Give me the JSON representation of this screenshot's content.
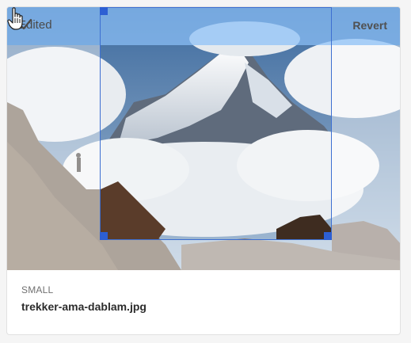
{
  "status": {
    "edited_label": "Edited",
    "revert_label": "Revert"
  },
  "asset": {
    "size_label": "SMALL",
    "filename": "trekker-ama-dablam.jpg"
  },
  "icons": {
    "status": "checkmark-icon",
    "cursor": "hand-pointer-icon"
  },
  "colors": {
    "status_bar": "#8CC0F8",
    "crop_border": "#3D6FD1",
    "crop_handle": "#2D5FD3"
  }
}
